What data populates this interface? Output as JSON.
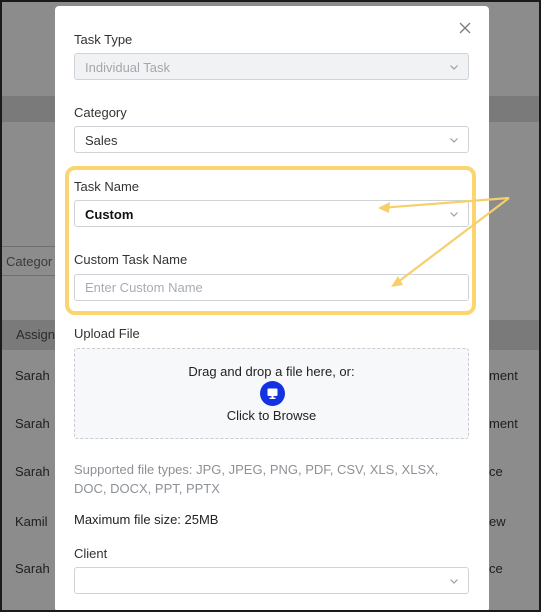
{
  "background": {
    "category_filter": "Categor",
    "column_header": "Assign",
    "rows_left": [
      "Sarah",
      "Sarah",
      "Sarah",
      "Kamil",
      "Sarah"
    ],
    "rows_right": [
      "ment",
      "ment",
      "ce",
      "ew",
      "ce"
    ]
  },
  "modal": {
    "task_type": {
      "label": "Task Type",
      "value": "Individual Task"
    },
    "category": {
      "label": "Category",
      "value": "Sales"
    },
    "task_name": {
      "label": "Task Name",
      "value": "Custom"
    },
    "custom_task_name": {
      "label": "Custom Task Name",
      "placeholder": "Enter Custom Name"
    },
    "upload": {
      "label": "Upload File",
      "drag_text": "Drag and drop a file here, or:",
      "browse_text": "Click to Browse",
      "icon": "monitor-icon"
    },
    "supported_types": "Supported file types: JPG, JPEG, PNG, PDF, CSV, XLS, XLSX, DOC, DOCX, PPT, PPTX",
    "max_size": "Maximum file size: 25MB",
    "client": {
      "label": "Client",
      "value": ""
    }
  },
  "annotation": {
    "highlight_color": "#fbd56f",
    "arrow_color": "#f5cf6a"
  },
  "colors": {
    "browse_icon": "#1433e0",
    "overlay": "#8c8c8c"
  }
}
